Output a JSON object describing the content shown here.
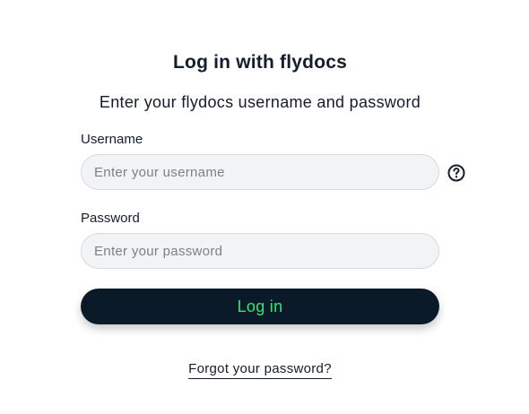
{
  "header": {
    "title": "Log in with flydocs",
    "subtitle": "Enter your flydocs username and password"
  },
  "form": {
    "username": {
      "label": "Username",
      "placeholder": "Enter your username",
      "value": ""
    },
    "password": {
      "label": "Password",
      "placeholder": "Enter your password",
      "value": ""
    },
    "help_icon": "question-circle-icon",
    "submit_label": "Log in",
    "forgot_link": "Forgot your password?"
  },
  "colors": {
    "button_background": "#0b1a29",
    "button_text": "#2ee87a",
    "field_background": "#f2f3f5",
    "text": "#141d2b"
  }
}
